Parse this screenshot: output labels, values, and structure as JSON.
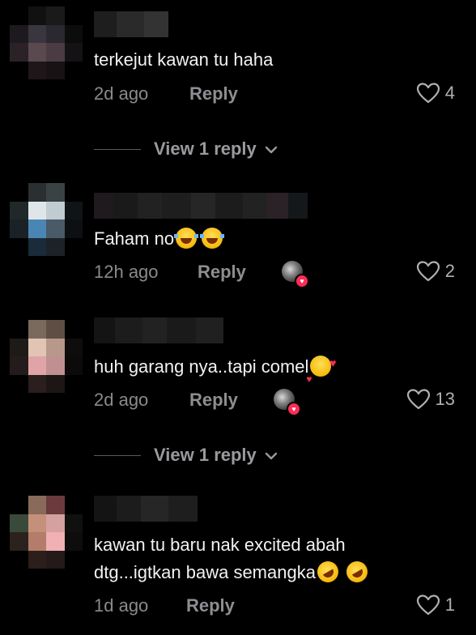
{
  "comments": [
    {
      "text": "terkejut kawan tu haha",
      "time": "2d ago",
      "reply_label": "Reply",
      "likes": "4",
      "view_replies": "View 1 reply",
      "creator_liked": false
    },
    {
      "text": "Faham no",
      "emoji": "face-with-tears-of-joy",
      "time": "12h ago",
      "reply_label": "Reply",
      "likes": "2",
      "creator_liked": true
    },
    {
      "text": "huh garang nya..tapi comel",
      "emoji": "smiling-face-with-hearts",
      "time": "2d ago",
      "reply_label": "Reply",
      "likes": "13",
      "view_replies": "View 1 reply",
      "creator_liked": true
    },
    {
      "text_line1": "kawan tu baru nak excited abah",
      "text_line2": "dtg...igtkan bawa semangka",
      "emoji": "rolling-on-the-floor-laughing",
      "time": "1d ago",
      "reply_label": "Reply",
      "likes": "1",
      "creator_liked": false
    }
  ],
  "colors": {
    "background": "#000000",
    "text": "#f2f2f2",
    "secondary": "#8a8a8e",
    "creator_heart": "#fe2c55"
  }
}
